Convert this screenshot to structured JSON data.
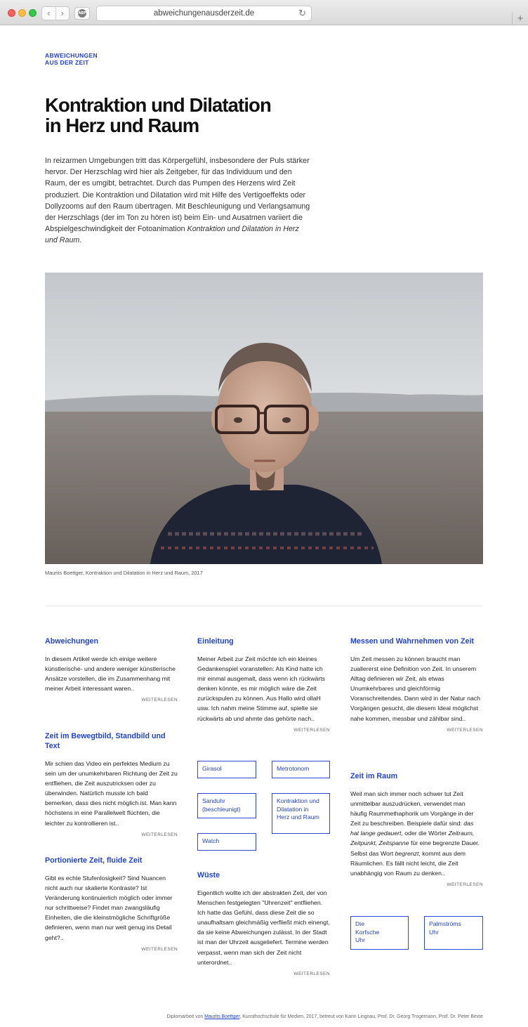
{
  "browser": {
    "url": "abweichungenausderzeit.de",
    "back_glyph": "‹",
    "forward_glyph": "›",
    "reload_glyph": "↻",
    "new_tab_glyph": "+",
    "abp_label": "ABP"
  },
  "site": {
    "logo_line1": "ABWEICHUNGEN",
    "logo_line2": "AUS DER ZEIT",
    "accent_color": "#2142cf"
  },
  "article": {
    "title_line1": "Kontraktion und Dilatation",
    "title_line2": "in Herz und Raum",
    "intro_text": "In reizarmen Umgebungen tritt das Körpergefühl, insbesondere der Puls stärker hervor. Der Herzschlag wird hier als Zeitgeber, für das Individuum und den Raum, der es umgibt, betrachtet. Durch das Pumpen des Herzens wird Zeit produziert. Die Kontraktion und Dilatation wird mit Hilfe des Vertigoeffekts oder Dollyzooms auf den Raum übertragen. Mit Beschleunigung und Verlangsamung der Herzschlags (der im Ton zu hören ist) beim Ein- und Ausatmen variiert die Abspielgeschwindigkeit der Fotoanimation ",
    "intro_italic": "Kontraktion und Dilatation in Herz und Raum",
    "intro_end": ".",
    "caption": "Maurits Boettger, Kontraktion und Dilatation in Herz und Raum, 2017"
  },
  "more_label": "WEITERLESEN",
  "col1": [
    {
      "title": "Abweichungen",
      "text": "In diesem Artikel werde ich einige weitere künstlerische- und andere weniger künstlerische Ansätze vorstellen, die im Zusammenhang mit meiner Arbeit interessant waren.."
    },
    {
      "title": "Zeit im Bewegtbild, Standbild und Text",
      "text": "Mir schien das Video ein perfektes Medium zu sein um der unumkehrbaren Richtung der Zeit zu entfliehen, die Zeit auszutricksen oder zu überwinden. Natürlich musste ich bald bemerken, dass dies nicht möglich ist. Man kann höchstens in eine Parallelwelt flüchten, die leichter zu kontrollieren ist.."
    },
    {
      "title": "Portionierte Zeit, fluide Zeit",
      "text": "Gibt es echte Stufenlosigkeit? Sind Nuancen nicht auch nur skalierte Kontraste? Ist Veränderung kontinuierlich möglich oder immer nur schrittweise? Findet man zwangsläufig Einheiten, die die kleinstmögliche Schriftgröße definieren, wenn man nur weit genug ins Detail geht?.."
    }
  ],
  "col2": [
    {
      "title": "Einleitung",
      "text": "Meiner Arbeit zur Zeit möchte ich ein kleines Gedankenspiel voranstellen: Als Kind hatte ich mir einmal ausgemalt, dass wenn ich rückwärts denken könnte, es mir möglich wäre die Zeit zurückspulen zu können. Aus Hallo wird ollaH usw. Ich nahm meine Stimme auf, spielte sie rückwärts ab und ahmte das gehörte nach.."
    },
    {
      "title": "Wüste",
      "text": "Eigentlich wollte ich der abstrakten Zeit, der von Menschen festgelegten \"Uhrenzeit\" entfliehen. Ich hatte das Gefühl, dass diese Zeit die so unaufhaltsam gleichmäßig verfließt mich einengt, da sie keine Abweichungen zulässt. In der Stadt ist man der Uhrzeit ausgeliefert. Termine werden verpasst, wenn man sich der Zeit nicht unterordnet.."
    }
  ],
  "col3": [
    {
      "title": "Messen und Wahrnehmen von Zeit",
      "text": "Um Zeit messen zu können braucht man zuallererst eine Definition von Zeit. In unserem Alltag definieren wir Zeit, als etwas Unumkehrbares und gleichförmig Voranschreitendes. Dann wird in der Natur nach Vorgängen gesucht, die diesem Ideal möglichst nahe kommen, messbar und zählbar sind.."
    },
    {
      "title": "Zeit im Raum",
      "text_a": "Weil man sich immer noch schwer tut Zeit unmittelbar auszudrücken, verwendet man häufig Raummethaphorik um Vorgänge in der Zeit zu beschreiben. Beispiele dafür sind: ",
      "text_i1": "das hat lange gedauert",
      "text_b": ", oder die Wörter ",
      "text_i2": "Zeitraum, Zeitpunkt, Zeitspanne",
      "text_c": " für eine begrenzte Dauer. Selbst das Wort ",
      "text_i3": "begrenzt",
      "text_d": ", kommt aus dem Räumlichen. Es fällt nicht leicht, die Zeit unabhängig von Raum zu denken.."
    }
  ],
  "tags": {
    "girasol": "Girasol",
    "metrotonom": "Metrotonom",
    "sanduhr_1": "Sanduhr",
    "sanduhr_2": "(beschleunigt)",
    "kd_1": "Kontraktion und",
    "kd_2": "Dilatation in",
    "kd_3": "Herz und Raum",
    "watch": "Watch",
    "korf_1": "Die",
    "korf_2": "Korfsche",
    "korf_3": "Uhr",
    "palm_1": "Palmströms",
    "palm_2": "Uhr"
  },
  "footer": {
    "prefix": "Diplomarbeit von ",
    "author": "Maurits Boettger",
    "suffix": ", Kunsthochschule für Medien, 2017, betreut von Karin Lingnau, Prof. Dr. Georg Trogemann, Prof. Dr. Peter Bexte"
  }
}
